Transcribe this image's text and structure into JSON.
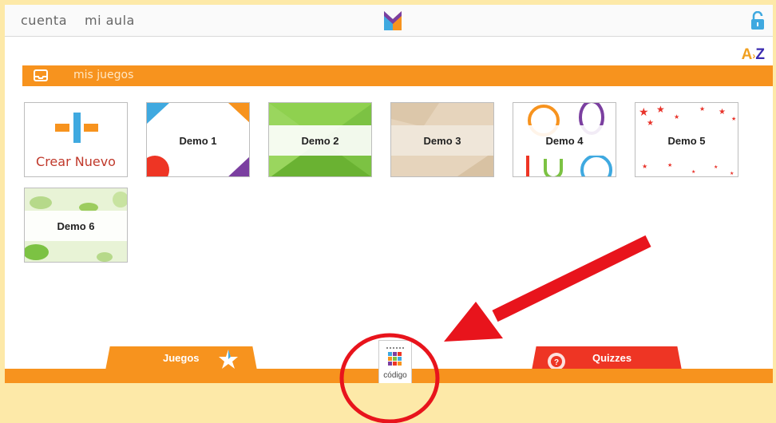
{
  "topbar": {
    "nav": [
      {
        "label": "cuenta"
      },
      {
        "label": "mi aula"
      }
    ],
    "sort_label_a": "A",
    "sort_label_z": "Z"
  },
  "section": {
    "title": "mis juegos"
  },
  "create_card": {
    "label": "Crear Nuevo"
  },
  "games": [
    {
      "label": "Demo 1"
    },
    {
      "label": "Demo 2"
    },
    {
      "label": "Demo 3"
    },
    {
      "label": "Demo 4"
    },
    {
      "label": "Demo 5"
    },
    {
      "label": "Demo 6"
    }
  ],
  "bottom_tabs": {
    "juegos": "Juegos",
    "codigo": "código",
    "quizzes": "Quizzes"
  },
  "colors": {
    "accent_orange": "#f7931e",
    "quiz_red": "#ee3524",
    "brand_blue": "#3fa9e0",
    "annotation_red": "#e8141c",
    "page_bg": "#fde9a8"
  },
  "icons": {
    "logo": "m-logo-icon",
    "lock": "unlock-icon",
    "inbox": "inbox-icon",
    "star": "star-icon",
    "bulb": "lightbulb-icon",
    "codigo": "grid-code-icon"
  }
}
